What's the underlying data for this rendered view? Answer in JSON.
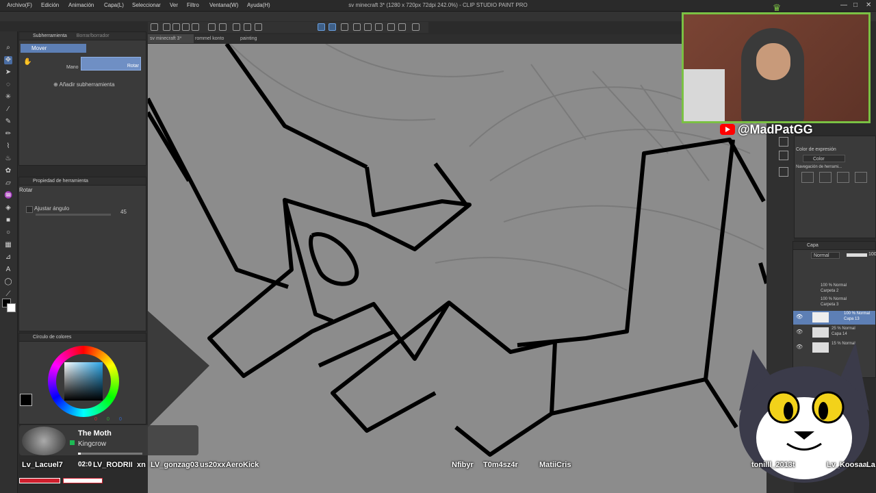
{
  "menu": [
    "Archivo(F)",
    "Edición",
    "Animación",
    "Capa(L)",
    "Seleccionar",
    "Ver",
    "Filtro",
    "Ventana(W)",
    "Ayuda(H)"
  ],
  "window_title": "sv minecraft 3* (1280 x 720px 72dpi 242.0%) - CLIP STUDIO PAINT PRO",
  "window_controls": {
    "minimize": "—",
    "maximize": "□",
    "close": "✕"
  },
  "doc_tabs": [
    "sv minecraft 3*",
    "rommel konto",
    "painting"
  ],
  "subtool_panel": {
    "title": "Subherramienta",
    "tab2": "Borrar/borrador",
    "selected_tool": "Mover",
    "hand_label": "Mano",
    "rotate_label": "Rotar",
    "add_subtool": "Añadir subherramienta"
  },
  "tool_property": {
    "title": "Propiedad de herramienta",
    "tool_name": "Rotar",
    "adjust_angle_label": "Ajustar ángulo",
    "angle_value": "45"
  },
  "color_panel": {
    "title": "Círculo de colores",
    "values": [
      "0",
      "0",
      "0"
    ]
  },
  "right_panel": {
    "expression_color_label": "Color de expresión",
    "color_value": "Color",
    "nav_label": "Navegación de herrami..."
  },
  "layers": {
    "panel_title": "Capa",
    "blend_mode": "Normal",
    "opacity": "100",
    "items": [
      {
        "opacity": "100 % Normal",
        "name": "Carpeta 2"
      },
      {
        "opacity": "100 % Normal",
        "name": "Carpeta 3"
      },
      {
        "opacity": "100 % Normal",
        "name": "Capa 13"
      },
      {
        "opacity": "25 % Normal",
        "name": "Capa 14"
      },
      {
        "opacity": "15 % Normal",
        "name": ""
      }
    ]
  },
  "stream": {
    "channel": "@MadPatGG",
    "now_playing_title": "The Moth",
    "now_playing_artist": "Kingcrow",
    "time": "02:0",
    "chat_names_left": [
      "Lv_Lacuel7",
      "LV_RODRII",
      "xn",
      "LV_gonzag03",
      "us20xx",
      "AeroKick"
    ],
    "chat_names_mid": [
      "Nfibyr",
      "T0m4sz4r",
      "MatiiCris"
    ],
    "chat_names_right": [
      "tonilll_2013t",
      "Lv_Koosaa",
      "La"
    ]
  },
  "colors": {
    "accent_green": "#7ac143",
    "youtube_red": "#ff0000",
    "canvas_gray": "#8c8c8c",
    "panel_bg": "#3a3a3a"
  }
}
